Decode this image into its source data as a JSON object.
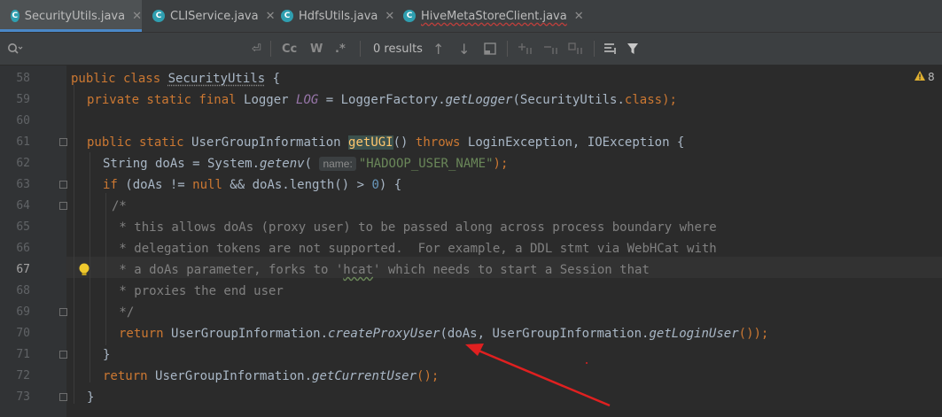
{
  "tabs": [
    {
      "label": "SecurityUtils.java"
    },
    {
      "label": "CLIService.java"
    },
    {
      "label": "HdfsUtils.java"
    },
    {
      "label": "HiveMetaStoreClient.java"
    }
  ],
  "search": {
    "results": "0 results",
    "case_label": "Cc",
    "word_label": "W",
    "regex_label": ".*"
  },
  "warnings": {
    "count": "8"
  },
  "editor": {
    "lines": [
      {
        "n": "58"
      },
      {
        "n": "59"
      },
      {
        "n": "60"
      },
      {
        "n": "61"
      },
      {
        "n": "62"
      },
      {
        "n": "63"
      },
      {
        "n": "64"
      },
      {
        "n": "65"
      },
      {
        "n": "66"
      },
      {
        "n": "67"
      },
      {
        "n": "68"
      },
      {
        "n": "69"
      },
      {
        "n": "70"
      },
      {
        "n": "71"
      },
      {
        "n": "72"
      },
      {
        "n": "73"
      }
    ],
    "code": {
      "l58_kw": "public class ",
      "l58_name": "SecurityUtils",
      "l58_rest": " {",
      "l59_kw": "private static final ",
      "l59_type": "Logger ",
      "l59_fld": "LOG",
      "l59_a": " = LoggerFactory.",
      "l59_m": "getLogger",
      "l59_b": "(SecurityUtils.",
      "l59_kw2": "class",
      "l59_c": ");",
      "l61_kw": "public static ",
      "l61_type": "UserGroupInformation ",
      "l61_m": "getUGI",
      "l61_b": "() ",
      "l61_kw2": "throws ",
      "l61_c": "LoginException, IOException {",
      "l62_a": "String doAs = System.",
      "l62_m": "getenv",
      "l62_b": "( ",
      "l62_hint": "name:",
      "l62_str": "\"HADOOP_USER_NAME\"",
      "l62_c": ");",
      "l63_kw": "if ",
      "l63_a": "(doAs != ",
      "l63_kw2": "null",
      "l63_b": " && doAs.length() > ",
      "l63_num": "0",
      "l63_c": ") {",
      "l64": "/*",
      "l65": " * this allows doAs (proxy user) to be passed along across process boundary where",
      "l66": " * delegation tokens are not supported.  For example, a DDL stmt via WebHCat with",
      "l67_a": " * a doAs parameter, forks to '",
      "l67_w": "hcat",
      "l67_b": "' which needs to start a Session that",
      "l68": " * proxies the end user",
      "l69": " */",
      "l70_kw": "return ",
      "l70_a": "UserGroupInformation.",
      "l70_m": "createProxyUser",
      "l70_b": "(doAs, UserGroupInformation.",
      "l70_m2": "getLoginUser",
      "l70_c": "());",
      "l71": "}",
      "l72_kw": "return ",
      "l72_a": "UserGroupInformation.",
      "l72_m": "getCurrentUser",
      "l72_b": "();",
      "l73": "}"
    }
  },
  "colors": {
    "arrow": "#e02020",
    "accent": "#4a88c7"
  }
}
